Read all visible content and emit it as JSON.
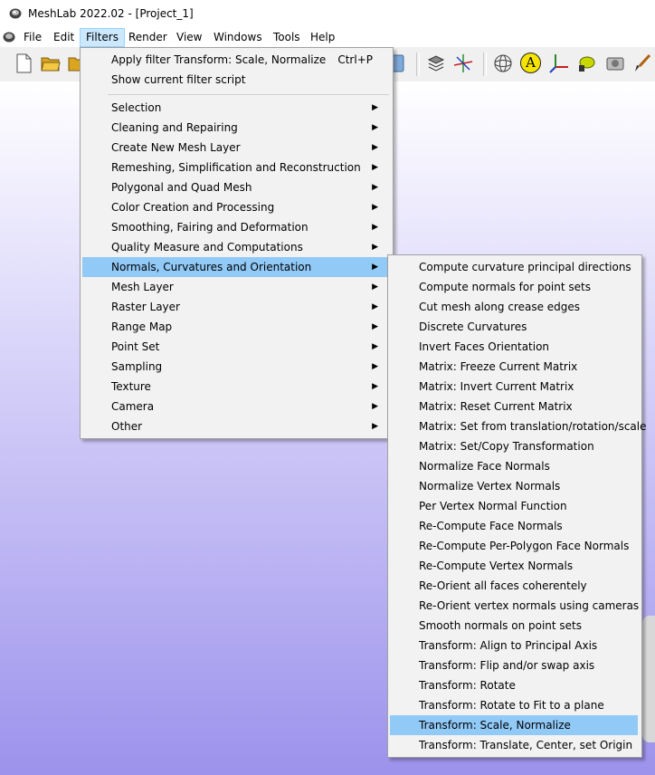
{
  "window": {
    "title": "MeshLab 2022.02 - [Project_1]"
  },
  "menubar": [
    "File",
    "Edit",
    "Filters",
    "Render",
    "View",
    "Windows",
    "Tools",
    "Help"
  ],
  "menubar_active": "Filters",
  "toolbar": {
    "icons": [
      "new-project-icon",
      "open-project-icon",
      "import-mesh-icon",
      "layer-icon",
      "bounding-box-icon",
      "axis-gizmo-icon",
      "sphere-view-icon",
      "annotation-icon",
      "axes-icon",
      "paint-icon",
      "camera-icon",
      "paintbrush-icon"
    ],
    "annotation_letter": "A"
  },
  "filters_menu": {
    "apply": "Apply filter Transform: Scale, Normalize",
    "apply_shortcut": "Ctrl+P",
    "show_script": "Show current filter script",
    "categories": [
      "Selection",
      "Cleaning and Repairing",
      "Create New Mesh Layer",
      "Remeshing, Simplification and Reconstruction",
      "Polygonal and Quad Mesh",
      "Color Creation and Processing",
      "Smoothing, Fairing and Deformation",
      "Quality Measure and Computations",
      "Normals, Curvatures and Orientation",
      "Mesh Layer",
      "Raster Layer",
      "Range Map",
      "Point Set",
      "Sampling",
      "Texture",
      "Camera",
      "Other"
    ],
    "highlighted_category": "Normals, Curvatures and Orientation"
  },
  "submenu": {
    "items": [
      "Compute curvature principal directions",
      "Compute normals for point sets",
      "Cut mesh along crease edges",
      "Discrete Curvatures",
      "Invert Faces Orientation",
      "Matrix: Freeze Current Matrix",
      "Matrix: Invert Current Matrix",
      "Matrix: Reset Current Matrix",
      "Matrix: Set from translation/rotation/scale",
      "Matrix: Set/Copy Transformation",
      "Normalize Face Normals",
      "Normalize Vertex Normals",
      "Per Vertex Normal Function",
      "Re-Compute Face Normals",
      "Re-Compute Per-Polygon Face Normals",
      "Re-Compute Vertex Normals",
      "Re-Orient all faces coherentely",
      "Re-Orient vertex normals using cameras",
      "Smooth normals on point sets",
      "Transform: Align to Principal Axis",
      "Transform: Flip and/or swap axis",
      "Transform: Rotate",
      "Transform: Rotate to Fit to a plane",
      "Transform: Scale, Normalize",
      "Transform: Translate, Center, set Origin"
    ],
    "highlighted_item": "Transform: Scale, Normalize"
  },
  "colors": {
    "menu_bg": "#f2f2f2",
    "highlight": "#91c9f7",
    "menubar_active": "#cce8ff",
    "viewport_top": "#ffffff",
    "viewport_bottom": "#9d92ec"
  }
}
